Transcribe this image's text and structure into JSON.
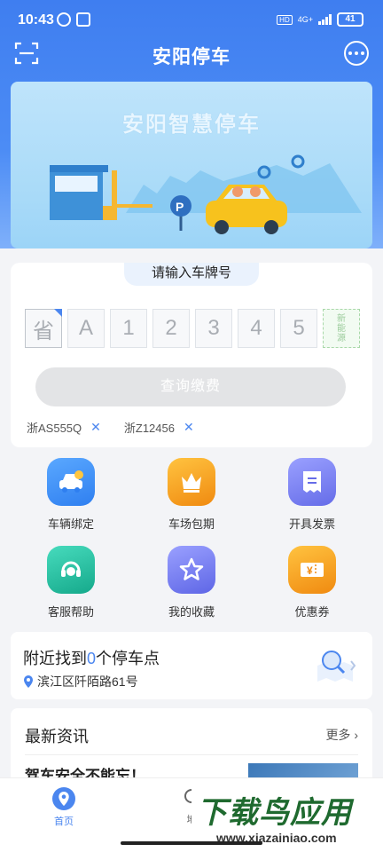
{
  "status_bar": {
    "time": "10:43",
    "hd": "HD",
    "network": "4G+",
    "battery": "41"
  },
  "header": {
    "title": "安阳停车"
  },
  "banner": {
    "title": "安阳智慧停车"
  },
  "plate_input": {
    "label": "请输入车牌号",
    "boxes": [
      "省",
      "A",
      "1",
      "2",
      "3",
      "4",
      "5"
    ],
    "new_energy": [
      "新",
      "能",
      "源"
    ],
    "query_button": "查询缴费",
    "recent": [
      "浙AS555Q",
      "浙Z12456"
    ]
  },
  "functions": [
    {
      "label": "车辆绑定",
      "icon": "car-bind-icon",
      "color": "#3b8ef5"
    },
    {
      "label": "车场包期",
      "icon": "crown-icon",
      "color": "#f7a21b"
    },
    {
      "label": "开具发票",
      "icon": "invoice-icon",
      "color": "#7b82f4"
    },
    {
      "label": "客服帮助",
      "icon": "headset-icon",
      "color": "#27c4a5"
    },
    {
      "label": "我的收藏",
      "icon": "star-icon",
      "color": "#7a7ff2"
    },
    {
      "label": "优惠券",
      "icon": "coupon-icon",
      "color": "#f79a1b"
    }
  ],
  "nearby": {
    "prefix": "附近找到",
    "count": "0",
    "suffix": "个停车点",
    "address": "滨江区阡陌路61号"
  },
  "news": {
    "title": "最新资讯",
    "more": "更多",
    "headline": "驾车安全不能忘！"
  },
  "bottom_nav": {
    "home": "首页",
    "map": "地"
  },
  "watermark": {
    "main": "下载鸟应用",
    "sub": "www.xiazainiao.com"
  },
  "colors": {
    "primary": "#4b86ef",
    "header_gradient_top": "#3f7ef0"
  }
}
